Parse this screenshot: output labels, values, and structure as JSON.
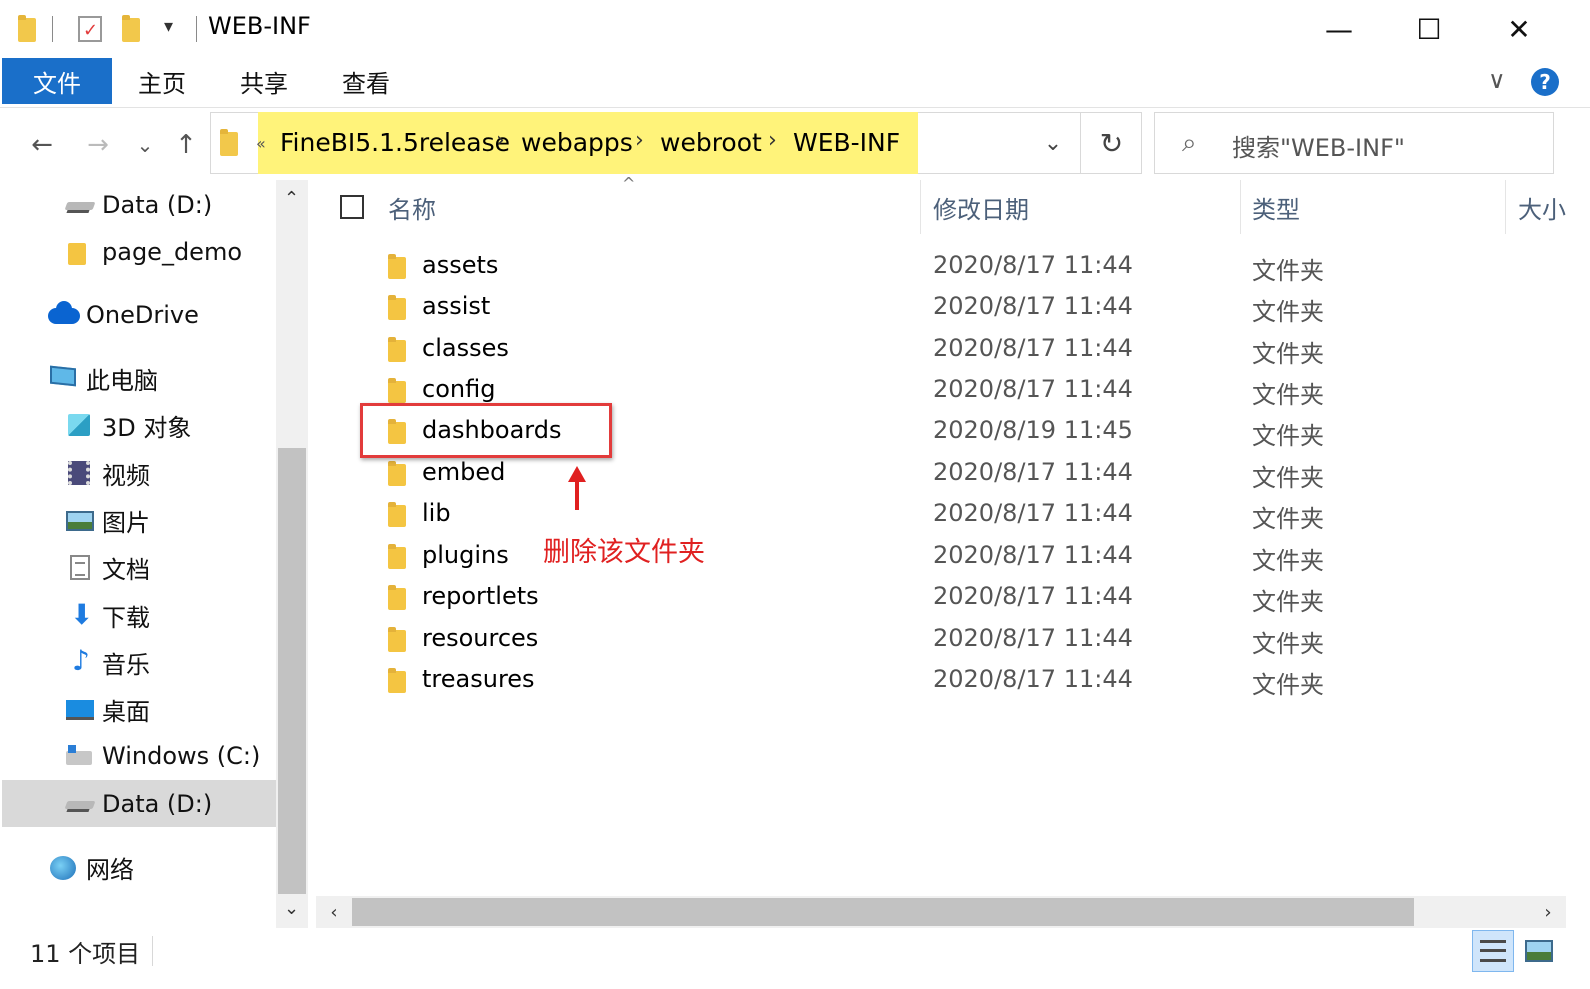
{
  "window": {
    "title": "WEB-INF",
    "minimize_glyph": "—",
    "maximize_glyph": "☐",
    "close_glyph": "✕"
  },
  "quick_access": {
    "dropdown_glyph": "▾"
  },
  "ribbon": {
    "file_tab": "文件",
    "tabs": [
      "主页",
      "共享",
      "查看"
    ],
    "expand_glyph": "∨",
    "help_glyph": "?"
  },
  "nav": {
    "back_glyph": "←",
    "forward_glyph": "→",
    "recent_glyph": "⌄",
    "up_glyph": "↑"
  },
  "address": {
    "overflow_glyph": "«",
    "segments": [
      "FineBI5.1.5release",
      "webapps",
      "webroot",
      "WEB-INF"
    ],
    "separator_glyph": "›",
    "dropdown_glyph": "⌄",
    "refresh_glyph": "↻",
    "highlight_color": "#fff37a"
  },
  "search": {
    "placeholder": "搜索\"WEB-INF\"",
    "icon": "search-icon"
  },
  "sidebar": {
    "items": [
      {
        "label": "Data (D:)",
        "icon": "drive-icon"
      },
      {
        "label": "page_demo",
        "icon": "folder-icon"
      },
      {
        "label": "OneDrive",
        "icon": "onedrive-icon"
      },
      {
        "label": "此电脑",
        "icon": "this-pc-icon"
      },
      {
        "label": "3D 对象",
        "icon": "3d-objects-icon"
      },
      {
        "label": "视频",
        "icon": "videos-icon"
      },
      {
        "label": "图片",
        "icon": "pictures-icon"
      },
      {
        "label": "文档",
        "icon": "documents-icon"
      },
      {
        "label": "下载",
        "icon": "downloads-icon"
      },
      {
        "label": "音乐",
        "icon": "music-icon"
      },
      {
        "label": "桌面",
        "icon": "desktop-icon"
      },
      {
        "label": "Windows (C:)",
        "icon": "windows-drive-icon"
      },
      {
        "label": "Data (D:)",
        "icon": "drive-icon"
      },
      {
        "label": "网络",
        "icon": "network-icon"
      }
    ],
    "selected_index": 12,
    "scroll_up_glyph": "⌃",
    "scroll_down_glyph": "⌄"
  },
  "columns": {
    "name": "名称",
    "modified": "修改日期",
    "type": "类型",
    "size": "大小",
    "sort_glyph": "^"
  },
  "files": [
    {
      "name": "assets",
      "modified": "2020/8/17 11:44",
      "type": "文件夹"
    },
    {
      "name": "assist",
      "modified": "2020/8/17 11:44",
      "type": "文件夹"
    },
    {
      "name": "classes",
      "modified": "2020/8/17 11:44",
      "type": "文件夹"
    },
    {
      "name": "config",
      "modified": "2020/8/17 11:44",
      "type": "文件夹"
    },
    {
      "name": "dashboards",
      "modified": "2020/8/19 11:45",
      "type": "文件夹"
    },
    {
      "name": "embed",
      "modified": "2020/8/17 11:44",
      "type": "文件夹"
    },
    {
      "name": "lib",
      "modified": "2020/8/17 11:44",
      "type": "文件夹"
    },
    {
      "name": "plugins",
      "modified": "2020/8/17 11:44",
      "type": "文件夹"
    },
    {
      "name": "reportlets",
      "modified": "2020/8/17 11:44",
      "type": "文件夹"
    },
    {
      "name": "resources",
      "modified": "2020/8/17 11:44",
      "type": "文件夹"
    },
    {
      "name": "treasures",
      "modified": "2020/8/17 11:44",
      "type": "文件夹"
    }
  ],
  "annotation": {
    "note": "删除该文件夹",
    "color": "#e02020"
  },
  "hscroll": {
    "left_glyph": "‹",
    "right_glyph": "›"
  },
  "status": {
    "item_count": "11 个项目"
  },
  "colors": {
    "accent": "#1a6fc9",
    "folder": "#f4c542"
  }
}
